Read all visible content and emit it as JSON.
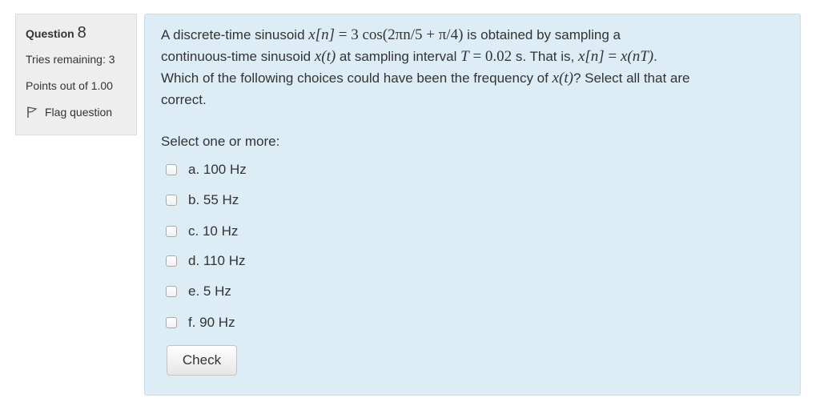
{
  "info": {
    "question_label": "Question",
    "question_number": "8",
    "tries_remaining": "Tries remaining: 3",
    "points": "Points out of 1.00",
    "flag_label": "Flag question"
  },
  "question": {
    "t1": "A discrete-time sinusoid ",
    "t2": " is obtained by sampling a",
    "t3": "continuous-time sinusoid ",
    "t4": " at sampling interval ",
    "t5": " s. That is, ",
    "t6": "Which of the following choices could have been the frequency of ",
    "t7": "? Select all that are",
    "t8": "correct.",
    "m_xn": "x[n]",
    "m_expr": "3 cos(2πn/5 + π/4)",
    "m_xt": "x(t)",
    "m_T": "T",
    "m_Tval": "0.02",
    "m_xnT": "x(nT)"
  },
  "prompt": "Select one or more:",
  "answers": [
    {
      "label": "a. 100 Hz",
      "checked": false
    },
    {
      "label": "b. 55 Hz",
      "checked": false
    },
    {
      "label": "c. 10 Hz",
      "checked": false
    },
    {
      "label": "d. 110 Hz",
      "checked": false
    },
    {
      "label": "e. 5 Hz",
      "checked": false
    },
    {
      "label": "f. 90 Hz",
      "checked": false
    }
  ],
  "check_button": "Check"
}
